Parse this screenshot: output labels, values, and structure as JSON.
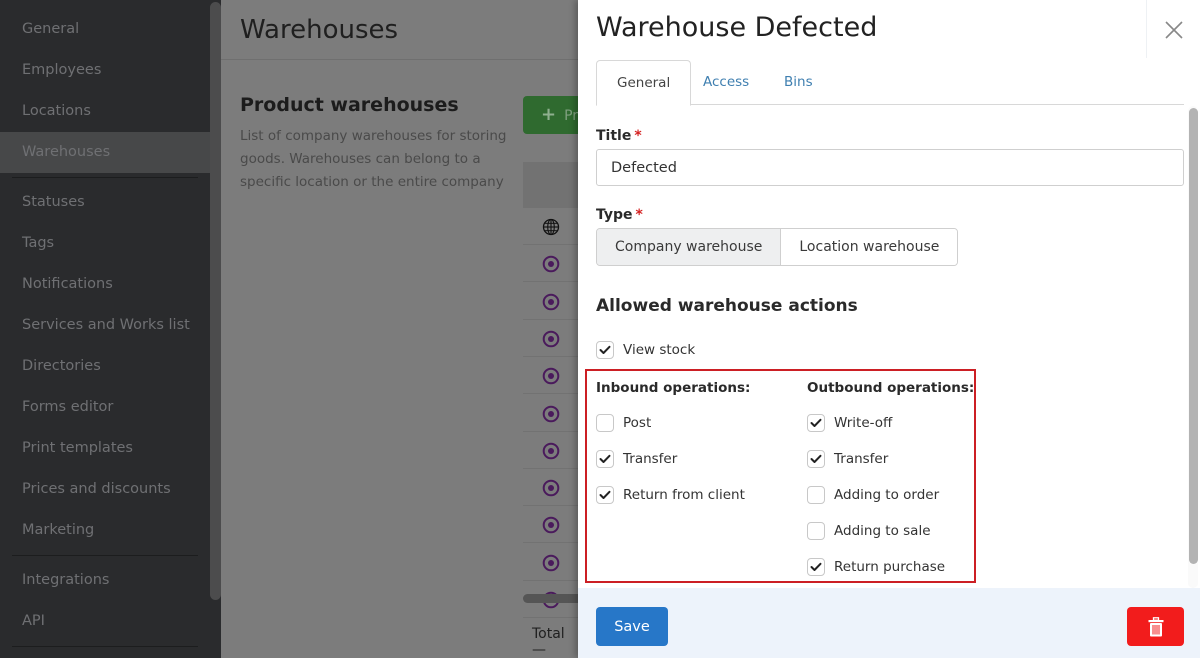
{
  "sidebar": {
    "groups": [
      [
        {
          "label": "General",
          "active": false
        },
        {
          "label": "Employees",
          "active": false
        },
        {
          "label": "Locations",
          "active": false
        },
        {
          "label": "Warehouses",
          "active": true
        }
      ],
      [
        {
          "label": "Statuses",
          "active": false
        },
        {
          "label": "Tags",
          "active": false
        },
        {
          "label": "Notifications",
          "active": false
        },
        {
          "label": "Services and Works list",
          "active": false
        },
        {
          "label": "Directories",
          "active": false
        },
        {
          "label": "Forms editor",
          "active": false
        },
        {
          "label": "Print templates",
          "active": false
        },
        {
          "label": "Prices and discounts",
          "active": false
        },
        {
          "label": "Marketing",
          "active": false
        }
      ],
      [
        {
          "label": "Integrations",
          "active": false
        },
        {
          "label": "API",
          "active": false
        }
      ]
    ]
  },
  "main": {
    "title": "Warehouses",
    "section_title": "Product warehouses",
    "section_desc": "List of company warehouses for storing goods. Warehouses can belong to a specific location or the entire company",
    "add_button_label": "Pr",
    "add_button_icon": "plus-icon",
    "rows": [
      {
        "icon": "globe-icon"
      },
      {
        "icon": "location-target-icon"
      },
      {
        "icon": "location-target-icon"
      },
      {
        "icon": "location-target-icon"
      },
      {
        "icon": "location-target-icon"
      },
      {
        "icon": "location-target-icon"
      },
      {
        "icon": "location-target-icon"
      },
      {
        "icon": "location-target-icon"
      },
      {
        "icon": "location-target-icon"
      },
      {
        "icon": "location-target-icon"
      },
      {
        "icon": "location-target-icon"
      }
    ],
    "total_label": "Total —"
  },
  "drawer": {
    "title": "Warehouse Defected",
    "close_icon": "close-icon",
    "tabs": [
      {
        "label": "General",
        "active": true
      },
      {
        "label": "Access",
        "active": false
      },
      {
        "label": "Bins",
        "active": false
      }
    ],
    "title_field": {
      "label": "Title",
      "required_mark": "*",
      "value": "Defected"
    },
    "type_field": {
      "label": "Type",
      "required_mark": "*",
      "options": [
        {
          "label": "Company warehouse",
          "selected": true
        },
        {
          "label": "Location warehouse",
          "selected": false
        }
      ]
    },
    "actions_heading": "Allowed warehouse actions",
    "view_stock": {
      "label": "View stock",
      "checked": true
    },
    "inbound": {
      "heading": "Inbound operations:",
      "items": [
        {
          "label": "Post",
          "checked": false
        },
        {
          "label": "Transfer",
          "checked": true
        },
        {
          "label": "Return from client",
          "checked": true
        }
      ]
    },
    "outbound": {
      "heading": "Outbound operations:",
      "items": [
        {
          "label": "Write-off",
          "checked": true
        },
        {
          "label": "Transfer",
          "checked": true
        },
        {
          "label": "Adding to order",
          "checked": false
        },
        {
          "label": "Adding to sale",
          "checked": false
        },
        {
          "label": "Return purchase",
          "checked": true
        }
      ]
    },
    "footer": {
      "save_label": "Save",
      "delete_icon": "trash-icon"
    }
  },
  "colors": {
    "primary": "#2777c8",
    "danger": "#f21c1c",
    "highlight": "#cc1f24",
    "success": "#2f6a2f",
    "location_icon": "#4a1a5c"
  }
}
